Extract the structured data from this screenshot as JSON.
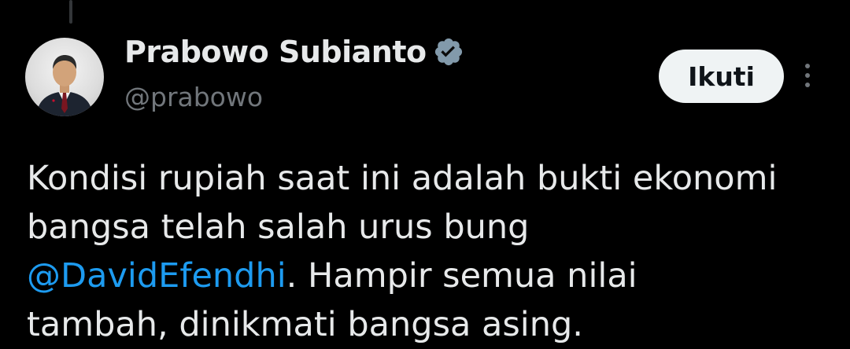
{
  "author": {
    "display_name": "Prabowo Subianto",
    "handle": "@prabowo",
    "verified_icon": "verified-badge-icon",
    "avatar_icon": "profile-photo"
  },
  "actions": {
    "follow_label": "Ikuti",
    "more_icon": "vertical-ellipsis-icon"
  },
  "tweet": {
    "line1": "Kondisi rupiah saat ini adalah bukti ekonomi",
    "line2": "bangsa telah salah urus bung",
    "mention": "@DavidEfendhi",
    "line3_rest": ". Hampir semua nilai",
    "line4": "tambah, dinikmati bangsa asing."
  },
  "colors": {
    "background": "#000000",
    "text_primary": "#e7e9ea",
    "text_secondary": "#71767b",
    "link": "#1d9bf0",
    "button_bg": "#eff3f4",
    "button_text": "#0f1419"
  }
}
